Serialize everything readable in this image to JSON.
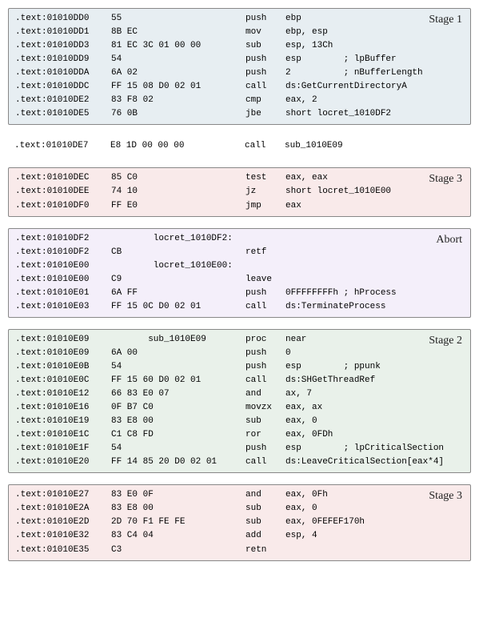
{
  "blocks": [
    {
      "id": "stage1",
      "bg": "bg-stage1",
      "label": "Stage 1",
      "lines": [
        {
          "addr": ".text:01010DD0",
          "hex": "55",
          "mn": "push",
          "op": "ebp"
        },
        {
          "addr": ".text:01010DD1",
          "hex": "8B EC",
          "mn": "mov",
          "op": "ebp, esp"
        },
        {
          "addr": ".text:01010DD3",
          "hex": "81 EC 3C 01 00 00",
          "mn": "sub",
          "op": "esp, 13Ch"
        },
        {
          "addr": ".text:01010DD9",
          "hex": "54",
          "mn": "push",
          "op": "esp        ; lpBuffer"
        },
        {
          "addr": ".text:01010DDA",
          "hex": "6A 02",
          "mn": "push",
          "op": "2          ; nBufferLength"
        },
        {
          "addr": ".text:01010DDC",
          "hex": "FF 15 08 D0 02 01",
          "mn": "call",
          "op": "ds:GetCurrentDirectoryA"
        },
        {
          "addr": ".text:01010DE2",
          "hex": "83 F8 02",
          "mn": "cmp",
          "op": "eax, 2"
        },
        {
          "addr": ".text:01010DE5",
          "hex": "76 0B",
          "mn": "jbe",
          "op": "short locret_1010DF2"
        }
      ]
    },
    {
      "id": "single",
      "bg": "bg-single",
      "label": "",
      "lines": [
        {
          "addr": ".text:01010DE7",
          "hex": "E8 1D 00 00 00",
          "mn": "call",
          "op": "sub_1010E09"
        }
      ]
    },
    {
      "id": "stage3a",
      "bg": "bg-stage3",
      "label": "Stage 3",
      "lines": [
        {
          "addr": ".text:01010DEC",
          "hex": "85 C0",
          "mn": "test",
          "op": "eax, eax"
        },
        {
          "addr": ".text:01010DEE",
          "hex": "74 10",
          "mn": "jz",
          "op": "short locret_1010E00"
        },
        {
          "addr": ".text:01010DF0",
          "hex": "FF E0",
          "mn": "jmp",
          "op": "eax"
        }
      ]
    },
    {
      "id": "abort",
      "bg": "bg-abort",
      "label": "Abort",
      "lines": [
        {
          "addr": ".text:01010DF2",
          "hex": "        locret_1010DF2:",
          "mn": "",
          "op": ""
        },
        {
          "addr": ".text:01010DF2",
          "hex": "CB",
          "mn": "retf",
          "op": ""
        },
        {
          "addr": ".text:01010E00",
          "hex": "        locret_1010E00:",
          "mn": "",
          "op": ""
        },
        {
          "addr": ".text:01010E00",
          "hex": "C9",
          "mn": "leave",
          "op": ""
        },
        {
          "addr": ".text:01010E01",
          "hex": "6A FF",
          "mn": "push",
          "op": "0FFFFFFFFh ; hProcess"
        },
        {
          "addr": ".text:01010E03",
          "hex": "FF 15 0C D0 02 01",
          "mn": "call",
          "op": "ds:TerminateProcess"
        }
      ]
    },
    {
      "id": "stage2",
      "bg": "bg-stage2",
      "label": "Stage 2",
      "lines": [
        {
          "addr": ".text:01010E09",
          "hex": "       sub_1010E09",
          "mn": "proc",
          "op": "near"
        },
        {
          "addr": ".text:01010E09",
          "hex": "6A 00",
          "mn": "push",
          "op": "0"
        },
        {
          "addr": ".text:01010E0B",
          "hex": "54",
          "mn": "push",
          "op": "esp        ; ppunk"
        },
        {
          "addr": ".text:01010E0C",
          "hex": "FF 15 60 D0 02 01",
          "mn": "call",
          "op": "ds:SHGetThreadRef"
        },
        {
          "addr": ".text:01010E12",
          "hex": "66 83 E0 07",
          "mn": "and",
          "op": "ax, 7"
        },
        {
          "addr": ".text:01010E16",
          "hex": "0F B7 C0",
          "mn": "movzx",
          "op": "eax, ax"
        },
        {
          "addr": ".text:01010E19",
          "hex": "83 E8 00",
          "mn": "sub",
          "op": "eax, 0"
        },
        {
          "addr": ".text:01010E1C",
          "hex": "C1 C8 FD",
          "mn": "ror",
          "op": "eax, 0FDh"
        },
        {
          "addr": ".text:01010E1F",
          "hex": "54",
          "mn": "push",
          "op": "esp        ; lpCriticalSection"
        },
        {
          "addr": ".text:01010E20",
          "hex": "FF 14 85 20 D0 02 01",
          "mn": "call",
          "op": "ds:LeaveCriticalSection[eax*4]"
        }
      ]
    },
    {
      "id": "stage3b",
      "bg": "bg-stage3",
      "label": "Stage 3",
      "lines": [
        {
          "addr": ".text:01010E27",
          "hex": "83 E0 0F",
          "mn": "and",
          "op": "eax, 0Fh"
        },
        {
          "addr": ".text:01010E2A",
          "hex": "83 E8 00",
          "mn": "sub",
          "op": "eax, 0"
        },
        {
          "addr": ".text:01010E2D",
          "hex": "2D 70 F1 FE FE",
          "mn": "sub",
          "op": "eax, 0FEFEF170h"
        },
        {
          "addr": ".text:01010E32",
          "hex": "83 C4 04",
          "mn": "add",
          "op": "esp, 4"
        },
        {
          "addr": ".text:01010E35",
          "hex": "C3",
          "mn": "retn",
          "op": ""
        }
      ]
    }
  ]
}
